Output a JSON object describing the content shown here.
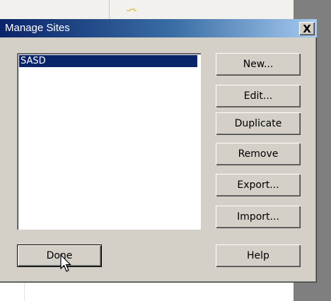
{
  "dialog": {
    "title": "Manage Sites",
    "close_label": "X"
  },
  "sites": {
    "items": [
      {
        "label": "SASD",
        "selected": true
      }
    ]
  },
  "buttons": {
    "new": "New...",
    "edit": "Edit...",
    "duplicate": "Duplicate",
    "remove": "Remove",
    "export": "Export...",
    "import": "Import...",
    "done": "Done",
    "help": "Help"
  },
  "colors": {
    "dialog_face": "#d4d0c8",
    "title_gradient_start": "#0a246a",
    "title_gradient_end": "#a6caf0",
    "selection": "#0a246a"
  },
  "icons": {
    "background_folder": "folder-icon",
    "pointer": "arrow-cursor-icon"
  }
}
